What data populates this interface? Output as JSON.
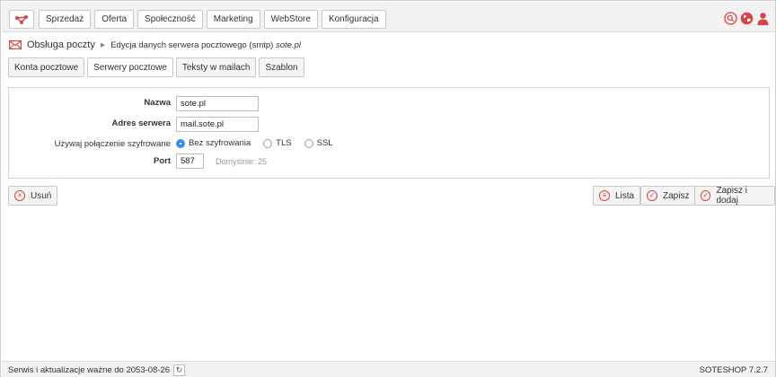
{
  "nav": {
    "items": [
      "Sprzedaż",
      "Oferta",
      "Społeczność",
      "Marketing",
      "WebStore",
      "Konfiguracja"
    ]
  },
  "top_icons": [
    "search-icon",
    "globe-icon",
    "user-icon"
  ],
  "breadcrumb": {
    "title": "Obsługa poczty",
    "sub_prefix": "Edycja danych serwera pocztowego (smtp)",
    "sub_name": "sote.pl"
  },
  "tabs": [
    {
      "label": "Konta pocztowe",
      "active": false
    },
    {
      "label": "Serwery pocztowe",
      "active": true
    },
    {
      "label": "Teksty w mailach",
      "active": false
    },
    {
      "label": "Szablon",
      "active": false
    }
  ],
  "form": {
    "name_label": "Nazwa",
    "name_value": "sote.pl",
    "server_label": "Adres serwera",
    "server_value": "mail.sote.pl",
    "encryption_label": "Używaj połączenie szyfrowane",
    "encryption_options": [
      "Bez szyfrowania",
      "TLS",
      "SSL"
    ],
    "encryption_selected": "Bez szyfrowania",
    "port_label": "Port",
    "port_value": "587",
    "port_hint": "Domyślnie: 25"
  },
  "actions": {
    "delete_label": "Usuń",
    "list_label": "Lista",
    "save_label": "Zapisz",
    "save_add_label": "Zapisz i dodaj"
  },
  "footer": {
    "service_text": "Serwis i aktualizacje ważne do 2053-08-26",
    "version": "SOTESHOP 7.2.7"
  },
  "colors": {
    "accent_red": "#d64545",
    "radio_blue": "#3d8de8"
  }
}
